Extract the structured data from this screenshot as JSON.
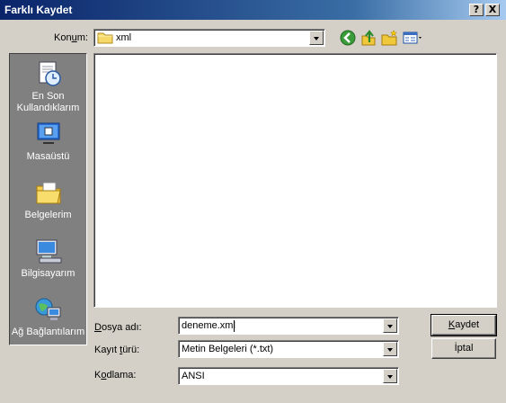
{
  "window": {
    "title": "Farklı Kaydet",
    "help_label": "?",
    "close_label": "X"
  },
  "location": {
    "label_pre": "Kon",
    "label_key": "u",
    "label_post": "m:",
    "value": "xml"
  },
  "toolbar": {
    "back_icon": "back-arrow-icon",
    "up_icon": "up-folder-icon",
    "new_folder_icon": "new-folder-icon",
    "views_icon": "views-menu-icon"
  },
  "places": [
    {
      "label_line1": "En Son",
      "label_line2": "Kullandıklarım",
      "icon": "recent-documents-icon"
    },
    {
      "label_line1": "Masaüstü",
      "label_line2": "",
      "icon": "desktop-icon"
    },
    {
      "label_line1": "Belgelerim",
      "label_line2": "",
      "icon": "my-documents-icon"
    },
    {
      "label_line1": "Bilgisayarım",
      "label_line2": "",
      "icon": "my-computer-icon"
    },
    {
      "label_line1": "Ağ Bağlantılarım",
      "label_line2": "",
      "icon": "network-places-icon"
    }
  ],
  "form": {
    "filename": {
      "label_key": "D",
      "label_rest": "osya adı:",
      "value": "deneme.xml"
    },
    "filetype": {
      "label_pre": "Kayıt ",
      "label_key": "t",
      "label_post": "ürü:",
      "value": "Metin Belgeleri (*.txt)"
    },
    "encoding": {
      "label_pre": "K",
      "label_key": "o",
      "label_post": "dlama:",
      "value": "ANSI"
    }
  },
  "buttons": {
    "save_key": "K",
    "save_rest": "aydet",
    "cancel": "İptal"
  }
}
